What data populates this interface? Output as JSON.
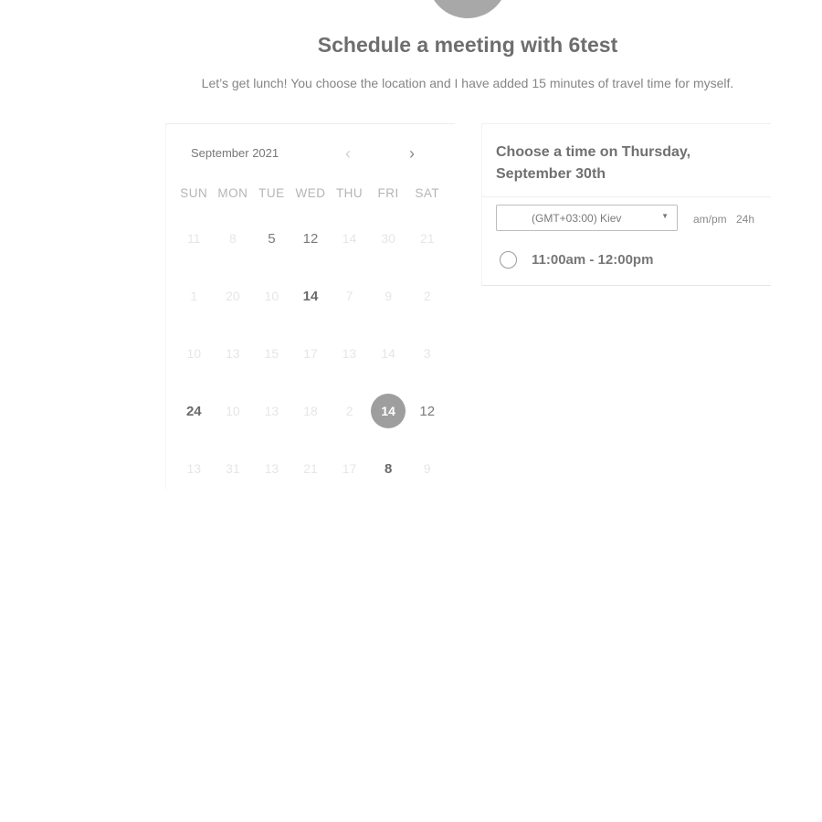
{
  "header": {
    "title": "Schedule a meeting with 6test",
    "subtitle": "Let’s get lunch! You choose the location and I have added 15 minutes of travel time for myself."
  },
  "calendar": {
    "month_label": "September 2021",
    "prev_icon": "‹",
    "next_icon": "›",
    "weekdays": [
      "SUN",
      "MON",
      "TUE",
      "WED",
      "THU",
      "FRI",
      "SAT"
    ],
    "weeks": [
      [
        {
          "label": "11",
          "state": "disabled"
        },
        {
          "label": "8",
          "state": "disabled"
        },
        {
          "label": "5",
          "state": "available"
        },
        {
          "label": "12",
          "state": "available"
        },
        {
          "label": "14",
          "state": "disabled"
        },
        {
          "label": "30",
          "state": "disabled"
        },
        {
          "label": "21",
          "state": "disabled"
        }
      ],
      [
        {
          "label": "1",
          "state": "disabled"
        },
        {
          "label": "20",
          "state": "disabled"
        },
        {
          "label": "10",
          "state": "disabled"
        },
        {
          "label": "14",
          "state": "bold"
        },
        {
          "label": "7",
          "state": "disabled"
        },
        {
          "label": "9",
          "state": "disabled"
        },
        {
          "label": "2",
          "state": "disabled"
        }
      ],
      [
        {
          "label": "10",
          "state": "disabled"
        },
        {
          "label": "13",
          "state": "disabled"
        },
        {
          "label": "15",
          "state": "disabled"
        },
        {
          "label": "17",
          "state": "disabled"
        },
        {
          "label": "13",
          "state": "disabled"
        },
        {
          "label": "14",
          "state": "disabled"
        },
        {
          "label": "3",
          "state": "disabled"
        }
      ],
      [
        {
          "label": "24",
          "state": "bold"
        },
        {
          "label": "10",
          "state": "disabled"
        },
        {
          "label": "13",
          "state": "disabled"
        },
        {
          "label": "18",
          "state": "disabled"
        },
        {
          "label": "2",
          "state": "disabled"
        },
        {
          "label": "14",
          "state": "selected"
        },
        {
          "label": "12",
          "state": "available"
        }
      ],
      [
        {
          "label": "13",
          "state": "disabled"
        },
        {
          "label": "31",
          "state": "disabled"
        },
        {
          "label": "13",
          "state": "disabled"
        },
        {
          "label": "21",
          "state": "disabled"
        },
        {
          "label": "17",
          "state": "disabled"
        },
        {
          "label": "8",
          "state": "bold"
        },
        {
          "label": "9",
          "state": "disabled"
        }
      ]
    ]
  },
  "time_panel": {
    "title": "Choose a time on Thursday, September 30th",
    "timezone": "(GMT+03:00) Kiev",
    "format_ampm": "am/pm",
    "format_24h": "24h",
    "slots": [
      {
        "label": "11:00am - 12:00pm"
      }
    ]
  },
  "colors": {
    "selected_day_bg": "#9e9e9e",
    "avatar": "#a8a8a8"
  }
}
